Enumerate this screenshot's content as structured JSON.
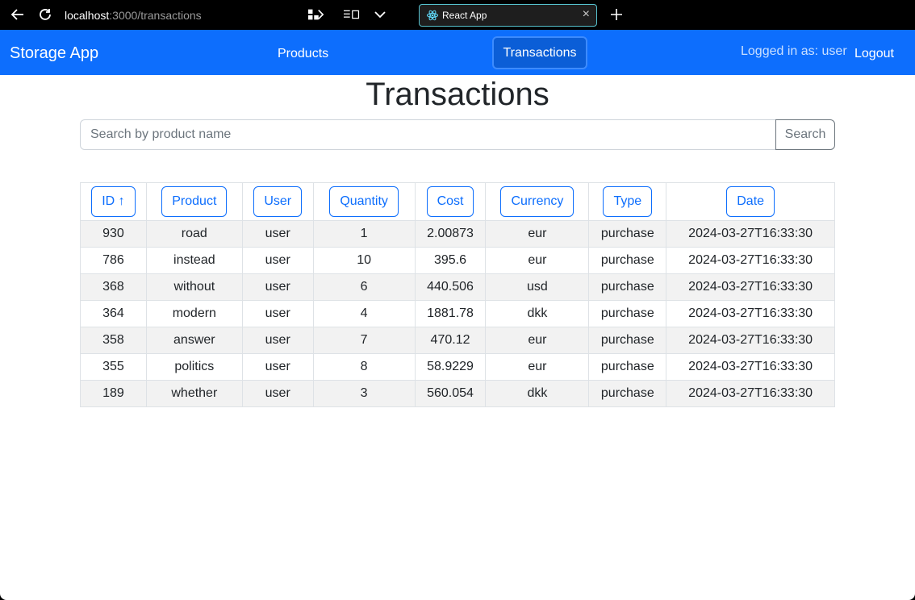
{
  "browser": {
    "url_host": "localhost",
    "url_rest": ":3000/transactions",
    "tab_title": "React App"
  },
  "navbar": {
    "brand": "Storage App",
    "products": "Products",
    "transactions": "Transactions",
    "logged_in": "Logged in as: user",
    "logout": "Logout"
  },
  "page": {
    "title": "Transactions"
  },
  "search": {
    "placeholder": "Search by product name",
    "button": "Search"
  },
  "table": {
    "headers": [
      "ID ↑",
      "Product",
      "User",
      "Quantity",
      "Cost",
      "Currency",
      "Type",
      "Date"
    ],
    "rows": [
      [
        "930",
        "road",
        "user",
        "1",
        "2.00873",
        "eur",
        "purchase",
        "2024-03-27T16:33:30"
      ],
      [
        "786",
        "instead",
        "user",
        "10",
        "395.6",
        "eur",
        "purchase",
        "2024-03-27T16:33:30"
      ],
      [
        "368",
        "without",
        "user",
        "6",
        "440.506",
        "usd",
        "purchase",
        "2024-03-27T16:33:30"
      ],
      [
        "364",
        "modern",
        "user",
        "4",
        "1881.78",
        "dkk",
        "purchase",
        "2024-03-27T16:33:30"
      ],
      [
        "358",
        "answer",
        "user",
        "7",
        "470.12",
        "eur",
        "purchase",
        "2024-03-27T16:33:30"
      ],
      [
        "355",
        "politics",
        "user",
        "8",
        "58.9229",
        "eur",
        "purchase",
        "2024-03-27T16:33:30"
      ],
      [
        "189",
        "whether",
        "user",
        "3",
        "560.054",
        "dkk",
        "purchase",
        "2024-03-27T16:33:30"
      ]
    ]
  },
  "colors": {
    "primary": "#0d6efd",
    "active_nav": "#0b5ed7"
  }
}
